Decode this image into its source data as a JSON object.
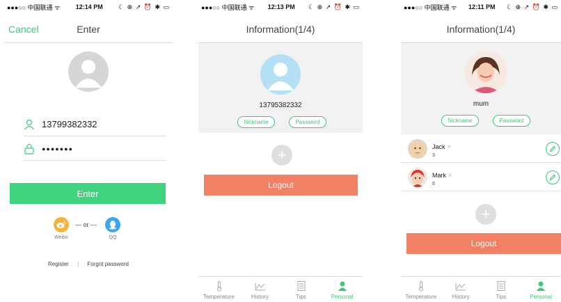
{
  "colors": {
    "accent": "#3cc878",
    "enter_button": "#3dd47d",
    "logout_button": "#f28064",
    "avatar_blue": "#b3e0f5"
  },
  "login_screen": {
    "status": {
      "carrier": "●●●○○ 中国联通 ᯤ",
      "time": "12:14 PM",
      "icons": "☾ ⊕ ↗ ⏰ ✱ ▭"
    },
    "nav": {
      "cancel": "Cancel",
      "title": "Enter"
    },
    "phone_value": "13799382332",
    "password_value": "●●●●●●●",
    "enter_button": "Enter",
    "or_text": "--- or ---",
    "social": {
      "weibo": "Weibo",
      "qq": "QQ"
    },
    "links": {
      "register": "Register",
      "separator": "|",
      "forgot": "Forgot password"
    }
  },
  "info_screen_1": {
    "status": {
      "carrier": "●●●○○ 中国联通 ᯤ",
      "time": "12:13 PM",
      "icons": "☾ ⊕ ↗ ⏰ ✱ ▭"
    },
    "nav": {
      "title": "Information(1/4)"
    },
    "phone": "13795382332",
    "nickname_button": "Nickname",
    "password_button": "Password",
    "add_icon": "+",
    "logout_button": "Logout",
    "tabs": [
      {
        "label": "Temperature",
        "icon": "thermometer-icon"
      },
      {
        "label": "History",
        "icon": "chart-icon"
      },
      {
        "label": "Tips",
        "icon": "document-icon"
      },
      {
        "label": "Personal",
        "icon": "person-icon"
      }
    ]
  },
  "info_screen_2": {
    "status": {
      "carrier": "●●●○○ 中国联通 ᯤ",
      "time": "12:11 PM",
      "icons": "☾ ⊕ ↗ ⏰ ✱ ▭"
    },
    "nav": {
      "title": "Information(1/4)"
    },
    "user_name": "mum",
    "nickname_button": "Nickname",
    "password_button": "Password",
    "children": [
      {
        "name": "Jack",
        "gender": "♂",
        "age": "3"
      },
      {
        "name": "Mark",
        "gender": "♂",
        "age": "6"
      }
    ],
    "add_icon": "+",
    "logout_button": "Logout",
    "tabs": [
      {
        "label": "Temperature",
        "icon": "thermometer-icon"
      },
      {
        "label": "History",
        "icon": "chart-icon"
      },
      {
        "label": "Tips",
        "icon": "document-icon"
      },
      {
        "label": "Personal",
        "icon": "person-icon"
      }
    ]
  }
}
